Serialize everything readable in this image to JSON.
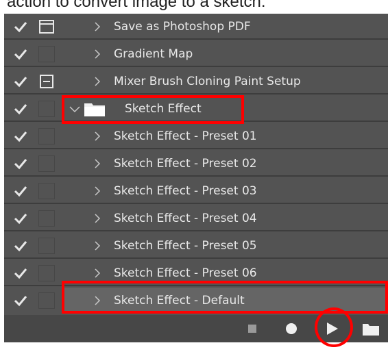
{
  "caption": "action to convert image to a sketch.",
  "actions": [
    {
      "label": "Save as Photoshop PDF",
      "checked": true,
      "dialog_icon": "dialog-window-icon",
      "type": "action"
    },
    {
      "label": "Gradient Map",
      "checked": true,
      "dialog_icon": null,
      "type": "action"
    },
    {
      "label": "Mixer Brush Cloning Paint Setup",
      "checked": true,
      "dialog_icon": "dialog-list-icon",
      "type": "action"
    },
    {
      "label": "Sketch Effect",
      "checked": true,
      "dialog_icon": null,
      "type": "set",
      "expanded": true
    },
    {
      "label": "Sketch Effect - Preset 01",
      "checked": true,
      "dialog_icon": null,
      "type": "action"
    },
    {
      "label": "Sketch Effect - Preset 02",
      "checked": true,
      "dialog_icon": null,
      "type": "action"
    },
    {
      "label": "Sketch Effect - Preset 03",
      "checked": true,
      "dialog_icon": null,
      "type": "action"
    },
    {
      "label": "Sketch Effect - Preset 04",
      "checked": true,
      "dialog_icon": null,
      "type": "action"
    },
    {
      "label": "Sketch Effect - Preset 05",
      "checked": true,
      "dialog_icon": null,
      "type": "action"
    },
    {
      "label": "Sketch Effect - Preset 06",
      "checked": true,
      "dialog_icon": null,
      "type": "action"
    },
    {
      "label": "Sketch Effect - Default",
      "checked": true,
      "dialog_icon": null,
      "type": "action",
      "selected": true
    }
  ],
  "toolbar": {
    "buttons": [
      "stop-icon",
      "record-icon",
      "play-icon",
      "new-set-folder-icon"
    ]
  },
  "colors": {
    "panel": "#535353",
    "selected_row": "#656565",
    "toolbar": "#474747",
    "highlight": "#ff0000",
    "text": "#e8e8e8"
  }
}
